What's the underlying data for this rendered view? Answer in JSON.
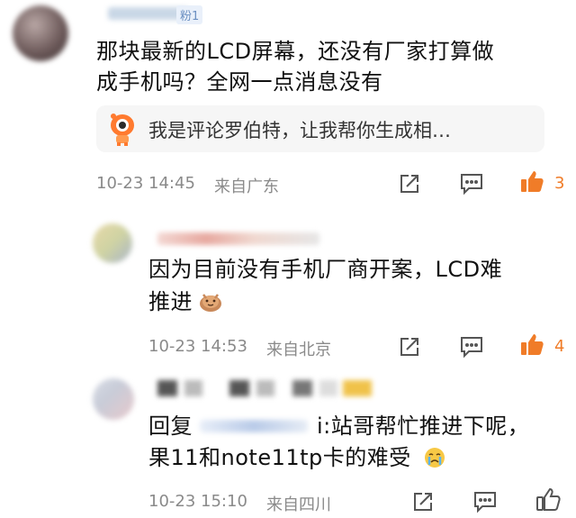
{
  "comments": [
    {
      "fan_badge": "粉1",
      "text_line1": "那块最新的LCD屏幕，还没有厂家打算做",
      "text_line2": "成手机吗？全网一点消息没有",
      "robot_reply": "我是评论罗伯特，让我帮你生成相…",
      "time": "10-23 14:45",
      "location": "来自广东",
      "likes": "3"
    },
    {
      "text_line1": "因为目前没有手机厂商开案，LCD难",
      "text_line2": "推进",
      "emoji": "doge-coin-emoji",
      "time": "10-23 14:53",
      "location": "来自北京",
      "likes": "4"
    },
    {
      "reply_prefix": "回复",
      "reply_suffix": "i:站哥帮忙推进下呢，",
      "text_line2": "果11和note11tp卡的难受",
      "emoji": "crying-face-emoji",
      "time": "10-23 15:10",
      "location": "来自四川",
      "likes": ""
    }
  ],
  "colors": {
    "like_active": "#f07c28",
    "meta_gray": "#8a8a8a",
    "bubble_bg": "#f6f6f6"
  }
}
